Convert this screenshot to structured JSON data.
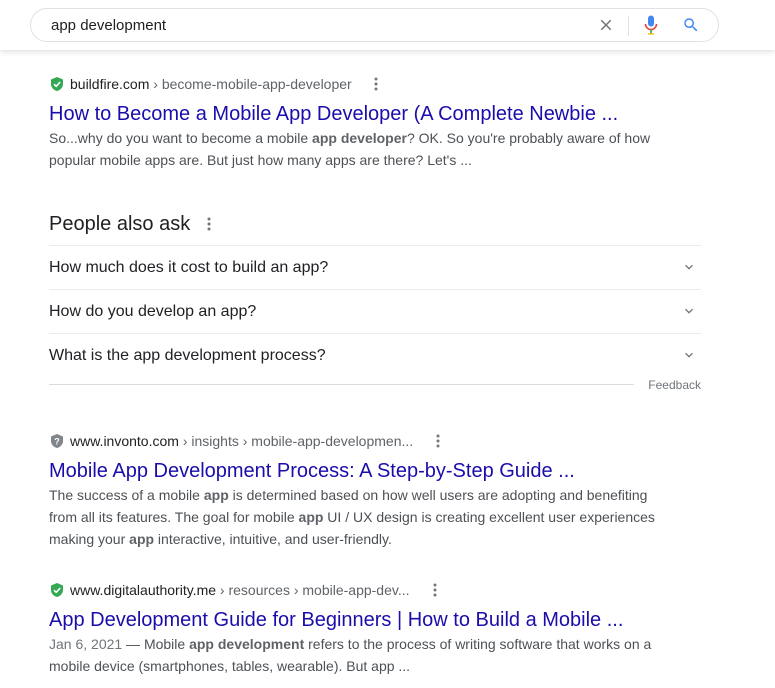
{
  "search": {
    "query": "app development",
    "clear_icon": "close-icon",
    "voice_icon": "microphone-icon",
    "search_icon": "search-icon"
  },
  "colors": {
    "link": "#1a0dab",
    "verified_green": "#34a853",
    "mic_blue": "#4285f4",
    "mic_red": "#ea4335",
    "search_blue": "#4285f4"
  },
  "results": [
    {
      "favicon": "verified-shield-icon",
      "domain": "buildfire.com",
      "path": " › become-mobile-app-developer",
      "title": "How to Become a Mobile App Developer (A Complete Newbie ...",
      "snippet": [
        {
          "t": "So...why do you want to become a mobile ",
          "b": false
        },
        {
          "t": "app developer",
          "b": true
        },
        {
          "t": "? OK. So you're probably aware of how popular mobile apps are. But just how many apps are there? Let's ...",
          "b": false
        }
      ]
    },
    {
      "favicon": "unverified-shield-icon",
      "domain": "www.invonto.com",
      "path": " › insights › mobile-app-developmen...",
      "title": "Mobile App Development Process: A Step-by-Step Guide ...",
      "snippet": [
        {
          "t": "The success of a mobile ",
          "b": false
        },
        {
          "t": "app",
          "b": true
        },
        {
          "t": " is determined based on how well users are adopting and benefiting from all its features. The goal for mobile ",
          "b": false
        },
        {
          "t": "app",
          "b": true
        },
        {
          "t": " UI / UX design is creating excellent user experiences making your ",
          "b": false
        },
        {
          "t": "app",
          "b": true
        },
        {
          "t": " interactive, intuitive, and user-friendly.",
          "b": false
        }
      ]
    },
    {
      "favicon": "verified-shield-icon",
      "domain": "www.digitalauthority.me",
      "path": " › resources › mobile-app-dev...",
      "title": "App Development Guide for Beginners | How to Build a Mobile ...",
      "date": "Jan 6, 2021",
      "snippet": [
        {
          "t": " — Mobile ",
          "b": false
        },
        {
          "t": "app development",
          "b": true
        },
        {
          "t": " refers to the process of writing software that works on a mobile device (smartphones, tables, wearable). But app ...",
          "b": false
        }
      ]
    }
  ],
  "paa": {
    "title": "People also ask",
    "questions": [
      "How much does it cost to build an app?",
      "How do you develop an app?",
      "What is the app development process?"
    ],
    "feedback": "Feedback"
  }
}
